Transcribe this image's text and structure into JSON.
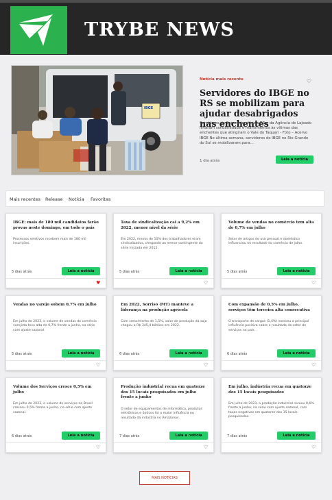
{
  "header": {
    "title": "TRYBE NEWS",
    "logo_icon": "trybe-logo-icon",
    "brand_color": "#2bb14d"
  },
  "hero": {
    "tag": "Notícia mais recente",
    "title": "Servidores do IBGE no RS se mobilizam para ajudar desabrigados nas enchentes",
    "description": "Servidores da Superintendência RS e da Agência de Lajeado levaram solidariedade e mantimentos às vítimas das enchentes que atingiram o Vale do Taquari - Foto – Acervo IBGE No última semana, servidores do IBGE no Rio Grande do Sul se mobilizaram para...",
    "time": "1 dia atrás",
    "button": "Leia a notícia",
    "van_label": "IBGE"
  },
  "tabs": [
    "Mais recentes",
    "Release",
    "Notícia",
    "Favoritas"
  ],
  "cards": [
    {
      "title": "IBGE: mais de 180 mil candidatos farão provas neste domingo, em todo o país",
      "description": "Processos seletivos recebem mais de 180 mil inscrições.",
      "time": "5 dias atrás",
      "button": "Leia a notícia",
      "favorite": true
    },
    {
      "title": "Taxa de sindicalização cai a 9,2% em 2022, menor nível da série",
      "description": "Em 2022, menos de 10% dos trabalhadores eram sindicalizados, chegando ao menor contingente da série iniciada em 2012.",
      "time": "5 dias atrás",
      "button": "Leia a notícia",
      "favorite": false
    },
    {
      "title": "Volume de vendas no comércio tem alta de 0,7% em julho",
      "description": "Setor de artigos de uso pessoal e doméstico influenciou no resultado do comércio de julho.",
      "time": "5 dias atrás",
      "button": "Leia a notícia",
      "favorite": false
    },
    {
      "title": "Vendas no varejo sobem 0,7% em julho",
      "description": "Em julho de 2023, o volume de vendas do comércio varejista teve alta de 0,7% frente a junho, na série com ajuste sazonal.",
      "time": "5 dias atrás",
      "button": "Leia a notícia",
      "favorite": false
    },
    {
      "title": "Em 2022, Sorriso (MT) manteve a liderança na produção agrícola",
      "description": "Com crescimento de 1,5%, valor de produção da soja chegou a R$ 345,4 bilhões em 2022.",
      "time": "6 dias atrás",
      "button": "Leia a notícia",
      "favorite": false
    },
    {
      "title": "Com expansão de 0,5% em julho, serviços têm terceira alta consecutiva",
      "description": "O transporte de cargas (1,4%) exerceu a principal influência positiva sobre o resultado do setor de serviços no país.",
      "time": "6 dias atrás",
      "button": "Leia a notícia",
      "favorite": false
    },
    {
      "title": "Volume dos Serviços cresce 0,5% em julho",
      "description": "Em julho de 2023, o volume de serviços no Brasil cresceu 0,5% frente a junho, na série com ajuste sazonal.",
      "time": "6 dias atrás",
      "button": "Leia a notícia",
      "favorite": false
    },
    {
      "title": "Produção industrial recua em quatorze dos 15 locais pesquisados em julho frente a junho",
      "description": "O setor de equipamentos de informática, produtos eletrônicos e ópticos foi a maior influência no resultado da indústria no Amazonas.",
      "time": "7 dias atrás",
      "button": "Leia a notícia",
      "favorite": false
    },
    {
      "title": "Em julho, indústria recua em quatorze dos 15 locais pesquisados",
      "description": "Em julho de 2023, a produção industrial recuou 0,6% frente a junho, na série com ajuste sazonal, com taxas negativas em quatorze dos 15 locais pesquisados.",
      "time": "7 dias atrás",
      "button": "Leia a notícia",
      "favorite": false
    }
  ],
  "more_button": "MAIS NOTÍCIAS",
  "colors": {
    "accent": "#22cc66",
    "tag": "#c0392b",
    "header_bg": "#262626"
  }
}
